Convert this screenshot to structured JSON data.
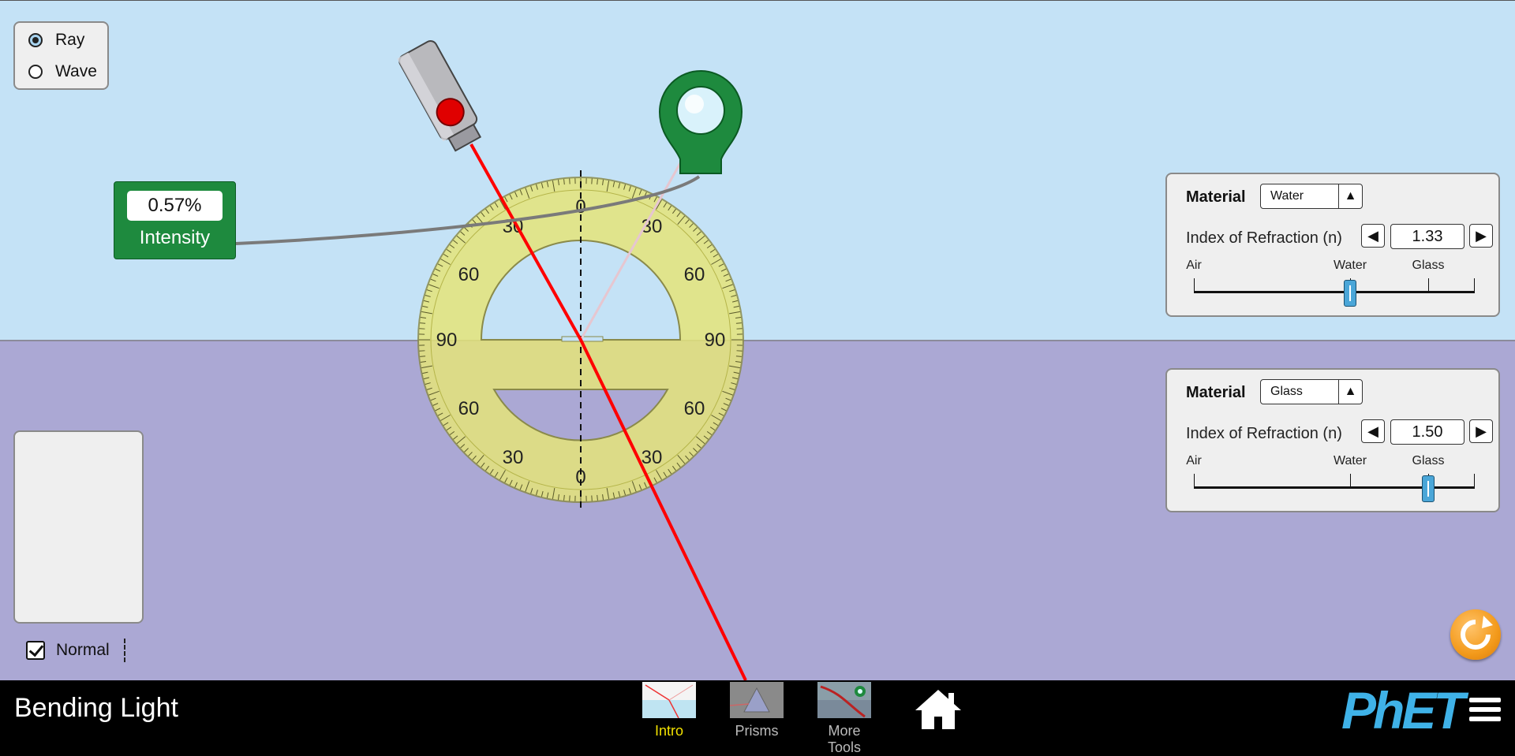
{
  "view_mode": {
    "options": [
      "Ray",
      "Wave"
    ],
    "selected": "Ray"
  },
  "intensity_meter": {
    "value": "0.57%",
    "label": "Intensity"
  },
  "protractor": {
    "labels": [
      "0",
      "30",
      "60",
      "90",
      "60",
      "30",
      "0",
      "30",
      "60",
      "90",
      "60",
      "30"
    ]
  },
  "normal_checkbox": {
    "label": "Normal",
    "checked": true
  },
  "top_material": {
    "title": "Material",
    "selected": "Water",
    "ior_label": "Index of Refraction (n)",
    "ior_value": "1.33",
    "slider_labels": [
      "Air",
      "Water",
      "Glass"
    ],
    "slider_fraction": 0.556
  },
  "bottom_material": {
    "title": "Material",
    "selected": "Glass",
    "ior_label": "Index of Refraction (n)",
    "ior_value": "1.50",
    "slider_labels": [
      "Air",
      "Water",
      "Glass"
    ],
    "slider_fraction": 0.833
  },
  "navbar": {
    "title": "Bending Light",
    "screens": [
      "Intro",
      "Prisms",
      "More Tools"
    ],
    "active_screen": "Intro",
    "logo": "PhET"
  },
  "colors": {
    "top_medium": "#c4e2f6",
    "bottom_medium": "#aba8d4",
    "laser_beam": "#ff0000",
    "intensity_green": "#1e8a3e",
    "reset_orange": "#f39a1b",
    "active_tab": "#f2e200"
  },
  "icons": [
    "laser-pointer-icon",
    "intensity-probe-icon",
    "reset-icon",
    "home-icon",
    "hamburger-menu-icon"
  ]
}
